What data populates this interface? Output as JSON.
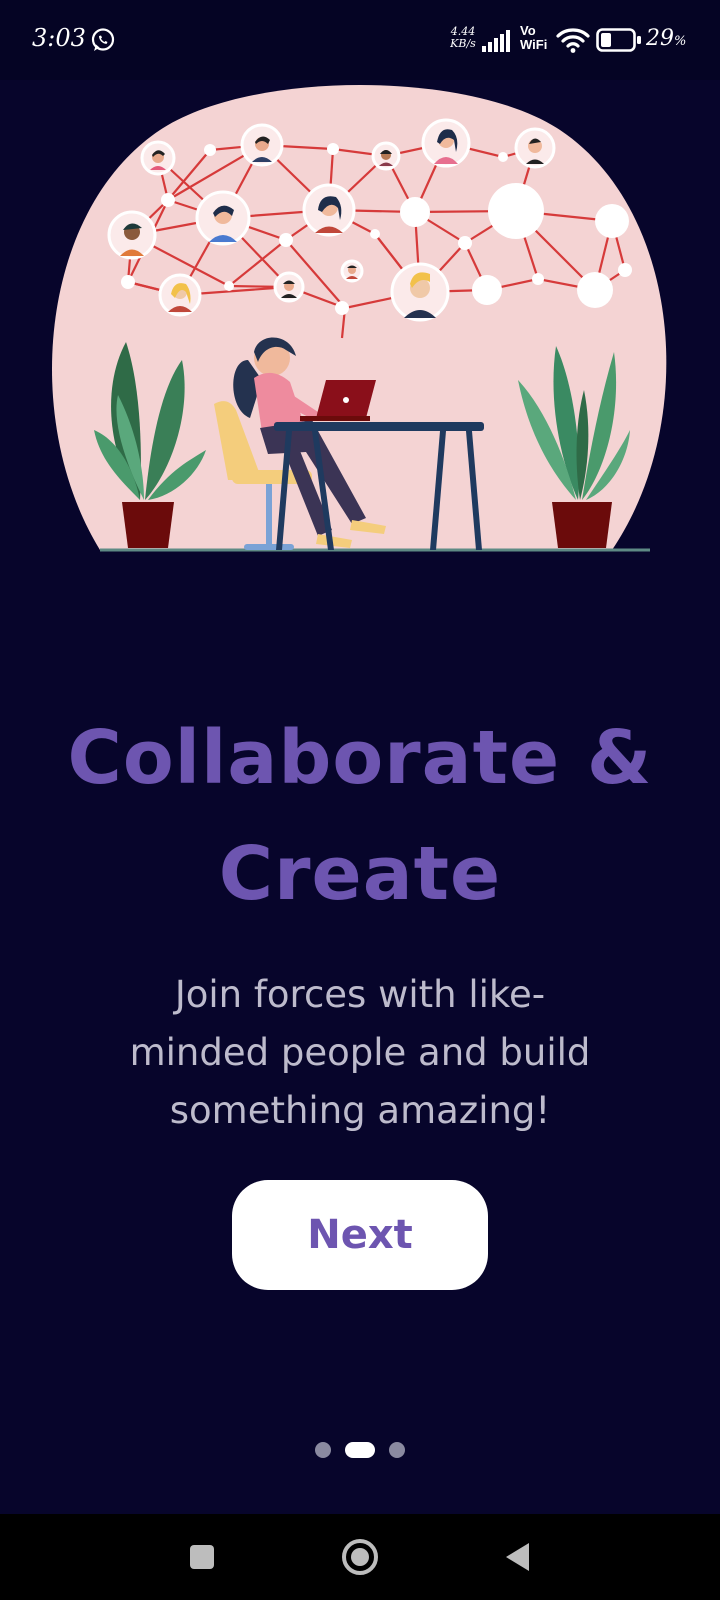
{
  "status_bar": {
    "time": "3:03",
    "network_speed_value": "4.44",
    "network_speed_unit": "KB/s",
    "vowifi_top": "Vo",
    "vowifi_bottom": "WiFi",
    "battery_percent": "29",
    "battery_unit": "%",
    "battery_level": 0.29,
    "icons": [
      "whatsapp-icon",
      "signal-icon",
      "wifi-icon",
      "battery-icon"
    ]
  },
  "onboarding": {
    "title_line1": "Collaborate &",
    "title_line2": "Create",
    "subtitle_line1": "Join forces with like-",
    "subtitle_line2": "minded people and build",
    "subtitle_line3": "something amazing!",
    "next_label": "Next",
    "page_count": 3,
    "current_page": 2
  },
  "nav_bar": {
    "icons": [
      "recents-square-icon",
      "home-circle-icon",
      "back-triangle-icon"
    ]
  },
  "colors": {
    "background": "#07052b",
    "accent": "#6d55b0",
    "button_bg": "#ffffff",
    "subtitle": "#bdbbcc",
    "illustration_blob": "#f4d3d3"
  }
}
